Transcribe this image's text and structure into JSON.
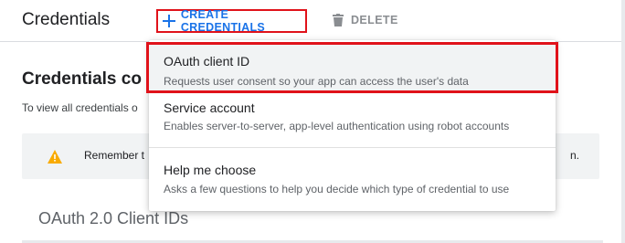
{
  "header": {
    "title": "Credentials",
    "create_label": "CREATE CREDENTIALS",
    "delete_label": "DELETE"
  },
  "content": {
    "heading": "Credentials co",
    "intro_text": "To view all credentials o",
    "notice_text": "Remember t",
    "notice_tail": "n.",
    "oauth_heading": "OAuth 2.0 Client IDs"
  },
  "menu": {
    "items": [
      {
        "title": "OAuth client ID",
        "description": "Requests user consent so your app can access the user's data"
      },
      {
        "title": "Service account",
        "description": "Enables server-to-server, app-level authentication using robot accounts"
      },
      {
        "title": "Help me choose",
        "description": "Asks a few questions to help you decide which type of credential to use"
      }
    ]
  },
  "colors": {
    "accent": "#1a73e8",
    "highlight_border": "#e0121a",
    "warning": "#f9ab00"
  }
}
